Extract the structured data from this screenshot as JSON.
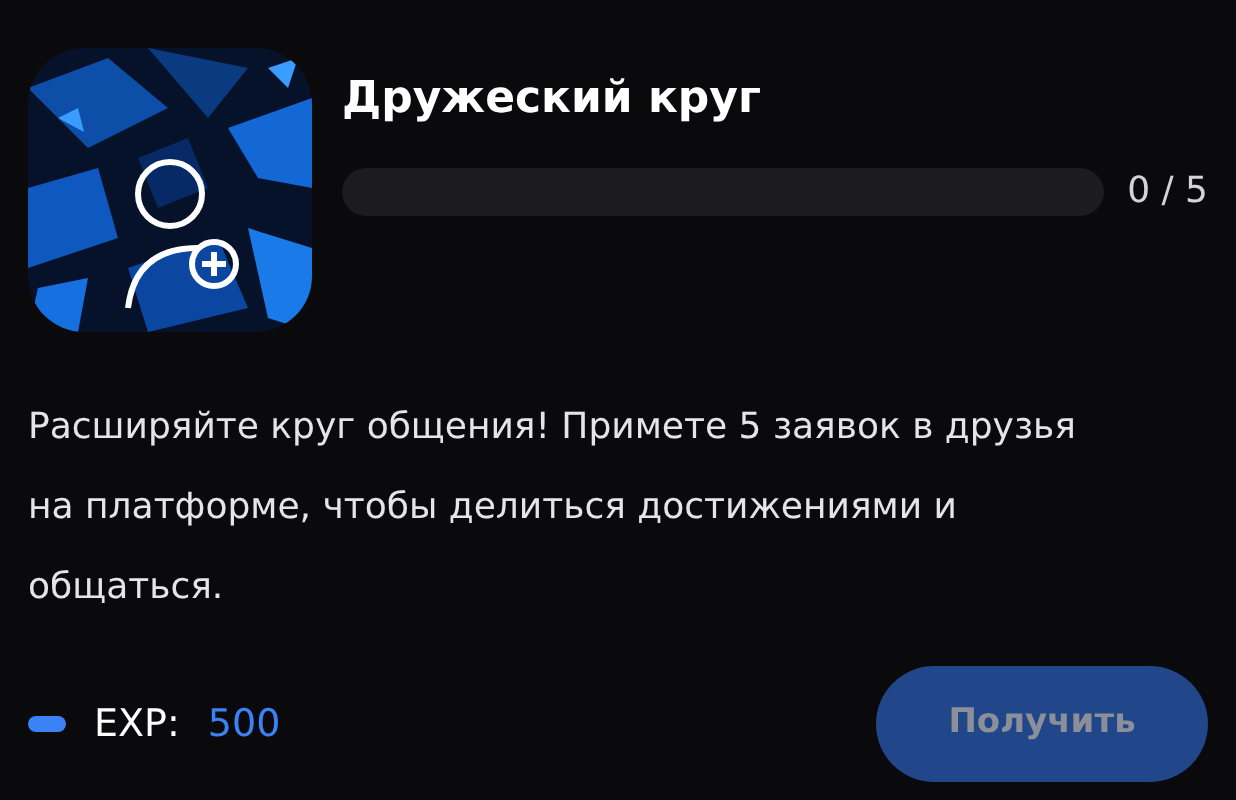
{
  "achievement": {
    "title": "Дружеский круг",
    "progress": {
      "level": 0,
      "reading": "0 / 5"
    },
    "description": "Расширяйте круг общения! Примете 5 заявок в друзья на платформе, чтобы делиться достижениями и общаться."
  },
  "reward": {
    "label": "EXP:",
    "value": "500"
  },
  "claim_button": {
    "label": "Получить",
    "disabled": true
  }
}
